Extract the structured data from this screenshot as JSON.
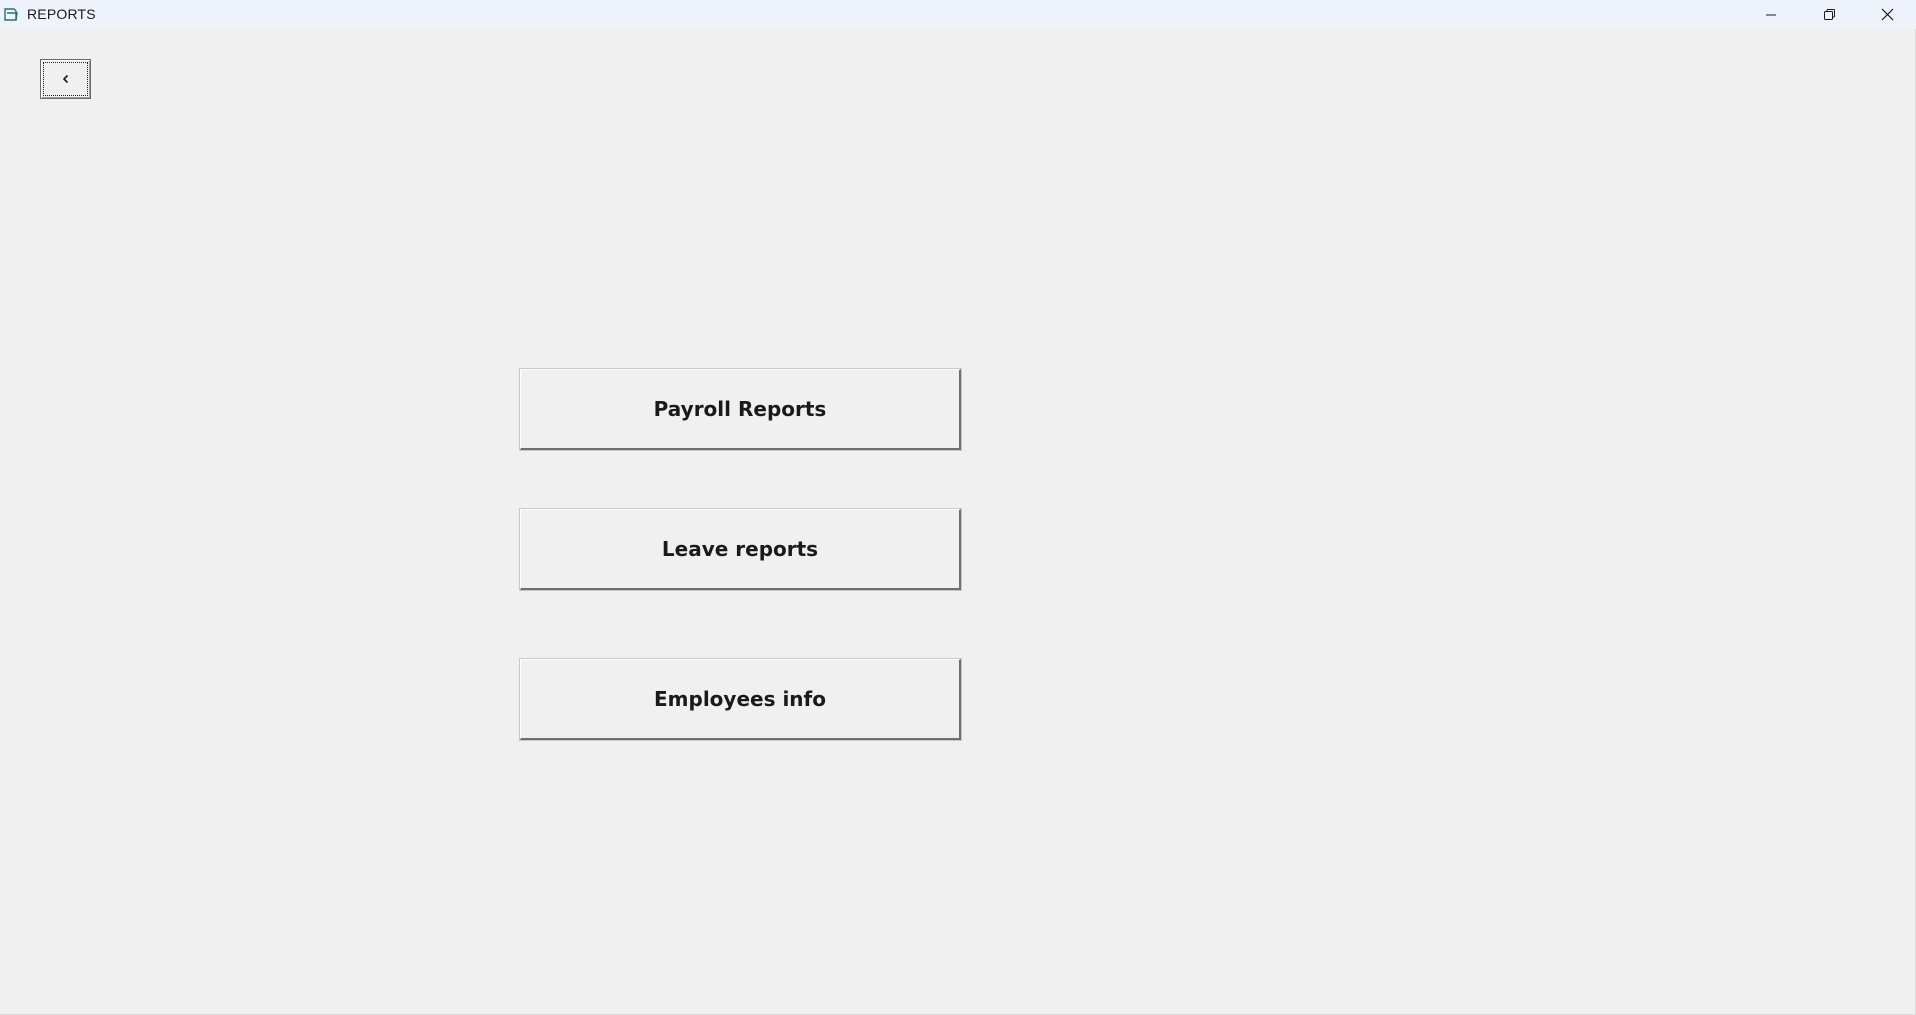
{
  "window": {
    "title": "REPORTS"
  },
  "toolbar": {
    "back_icon": "chevron-left-icon"
  },
  "menu": {
    "payroll_label": "Payroll Reports",
    "leave_label": "Leave reports",
    "employees_label": "Employees info"
  },
  "colors": {
    "background": "#f0f0f0",
    "titlebar": "#eef2fa",
    "icon_accent": "#2f6f6a"
  }
}
